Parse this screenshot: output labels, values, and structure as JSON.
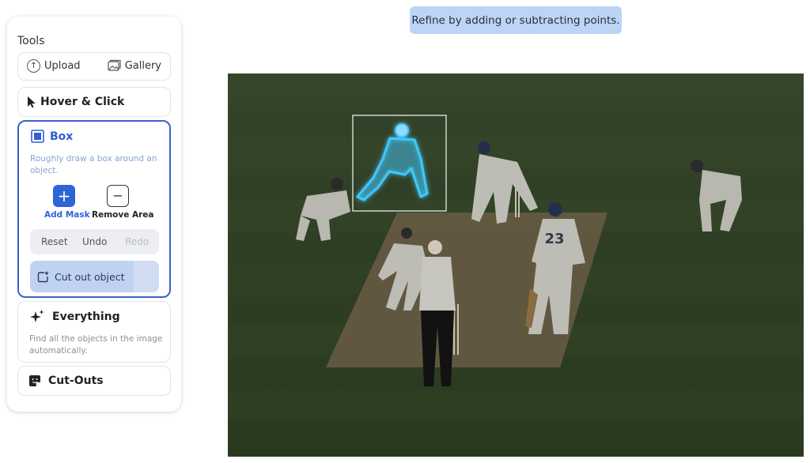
{
  "tools": {
    "title": "Tools",
    "upload_label": "Upload",
    "gallery_label": "Gallery",
    "hover_label": "Hover & Click",
    "box": {
      "title": "Box",
      "description": "Roughly draw a box around an object.",
      "add_mask_label": "Add Mask",
      "remove_area_label": "Remove Area",
      "reset_label": "Reset",
      "undo_label": "Undo",
      "redo_label": "Redo",
      "cut_out_label": "Cut out object"
    },
    "everything": {
      "title": "Everything",
      "description": "Find all the objects in the image automatically."
    },
    "cutouts_label": "Cut-Outs"
  },
  "hint": {
    "text": "Refine by adding or subtracting points."
  },
  "canvas": {
    "players": [
      {
        "number": "23"
      }
    ],
    "colors": {
      "field": "#2f3f22",
      "pitch": "#6b5c44",
      "mask_glow": "#41c8ff",
      "box": "#e8e8e8",
      "accent": "#2f63d8"
    }
  }
}
